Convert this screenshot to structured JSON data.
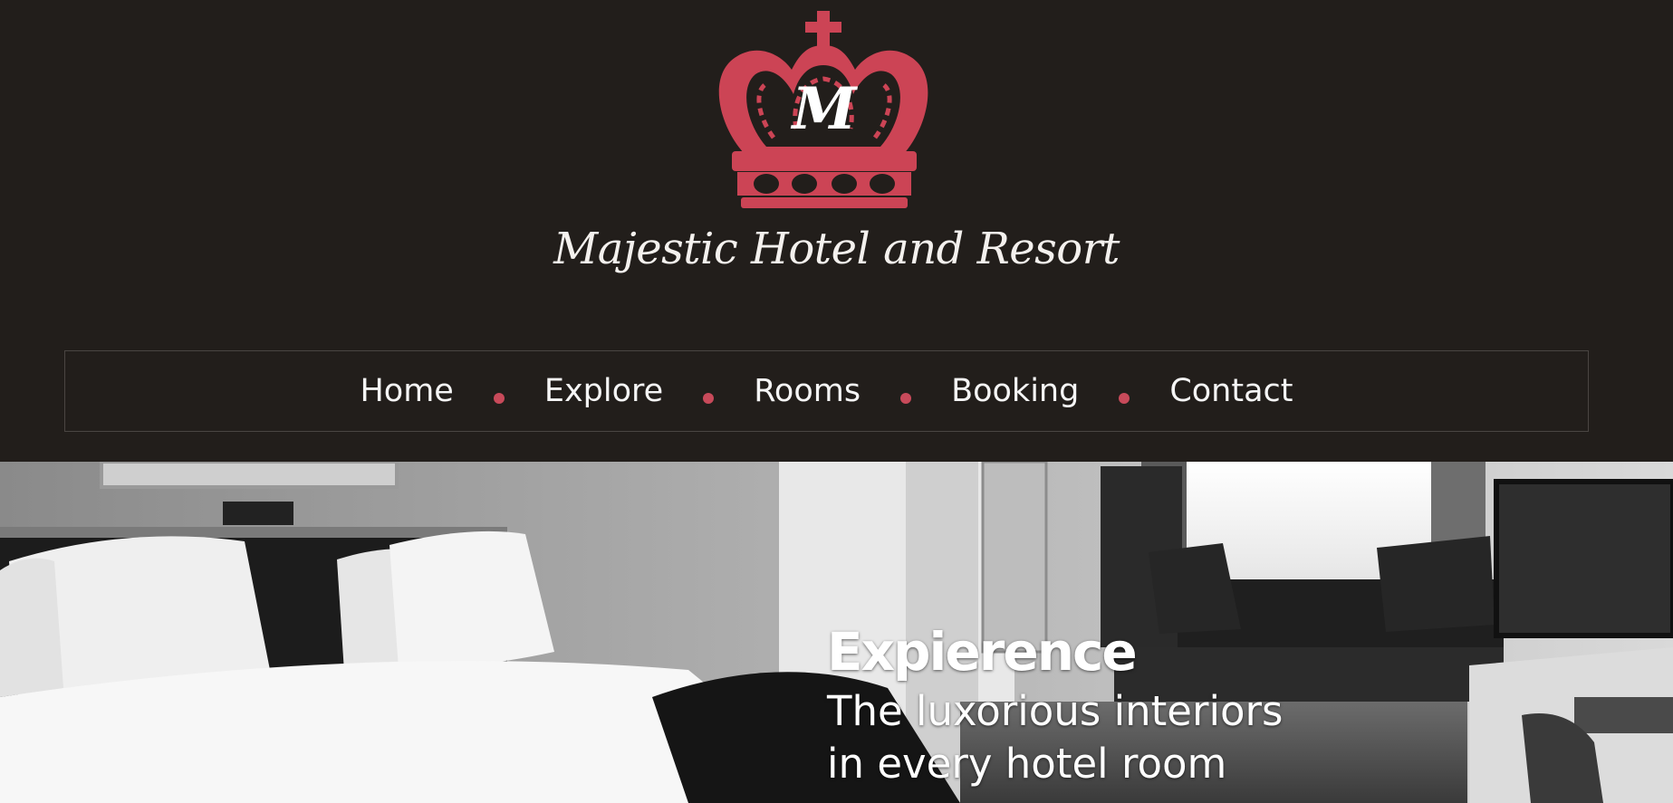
{
  "header": {
    "brand_name": "Majestic Hotel and Resort",
    "logo_monogram": "M",
    "logo_icon": "crown-icon"
  },
  "nav": {
    "items": [
      {
        "label": "Home"
      },
      {
        "label": "Explore"
      },
      {
        "label": "Rooms"
      },
      {
        "label": "Booking"
      },
      {
        "label": "Contact"
      }
    ]
  },
  "hero": {
    "heading": "Expierence",
    "subtitle": "The luxorious interiors in every hotel room"
  },
  "colors": {
    "background": "#221e1b",
    "accent": "#c84a5a",
    "text": "#f5f5f5"
  }
}
